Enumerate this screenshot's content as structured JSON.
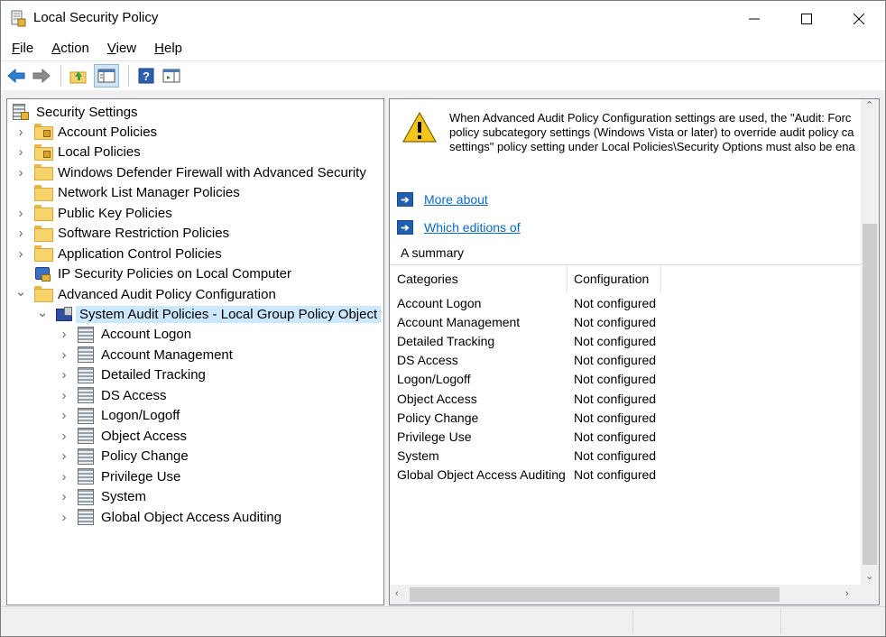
{
  "window": {
    "title": "Local Security Policy",
    "minimize_icon": "minimize-icon",
    "maximize_icon": "maximize-icon",
    "close_icon": "close-icon"
  },
  "menu": [
    {
      "label": "File",
      "accel": "F"
    },
    {
      "label": "Action",
      "accel": "A"
    },
    {
      "label": "View",
      "accel": "V"
    },
    {
      "label": "Help",
      "accel": "H"
    }
  ],
  "toolbar": [
    "back-arrow-icon",
    "forward-arrow-icon",
    "up-folder-icon",
    "show-hide-console-tree-icon",
    "help-icon",
    "show-hide-action-pane-icon"
  ],
  "tree": {
    "root": "Security Settings",
    "items": [
      {
        "label": "Account Policies",
        "expander": "collapsed",
        "icon": "folder-lock-icon"
      },
      {
        "label": "Local Policies",
        "expander": "collapsed",
        "icon": "folder-lock-icon"
      },
      {
        "label": "Windows Defender Firewall with Advanced Security",
        "expander": "collapsed",
        "icon": "folder-icon"
      },
      {
        "label": "Network List Manager Policies",
        "expander": "none",
        "icon": "folder-icon"
      },
      {
        "label": "Public Key Policies",
        "expander": "collapsed",
        "icon": "folder-icon"
      },
      {
        "label": "Software Restriction Policies",
        "expander": "collapsed",
        "icon": "folder-icon"
      },
      {
        "label": "Application Control Policies",
        "expander": "collapsed",
        "icon": "folder-icon"
      },
      {
        "label": "IP Security Policies on Local Computer",
        "expander": "none",
        "icon": "ip-security-icon"
      },
      {
        "label": "Advanced Audit Policy Configuration",
        "expander": "expanded",
        "icon": "folder-icon"
      }
    ],
    "selected": "System Audit Policies - Local Group Policy Object",
    "children": [
      "Account Logon",
      "Account Management",
      "Detailed Tracking",
      "DS Access",
      "Logon/Logoff",
      "Object Access",
      "Policy Change",
      "Privilege Use",
      "System",
      "Global Object Access Auditing"
    ]
  },
  "details": {
    "warning_lines": [
      "When Advanced Audit Policy Configuration settings are used, the \"Audit: Forc",
      "policy subcategory settings (Windows Vista or later) to override audit policy ca",
      "settings\" policy setting under Local Policies\\Security Options must also be ena"
    ],
    "link1": "More about",
    "link2": "Which editions of",
    "summary": "A summary",
    "columns": [
      "Categories",
      "Configuration"
    ],
    "rows": [
      [
        "Account Logon",
        "Not configured"
      ],
      [
        "Account Management",
        "Not configured"
      ],
      [
        "Detailed Tracking",
        "Not configured"
      ],
      [
        "DS Access",
        "Not configured"
      ],
      [
        "Logon/Logoff",
        "Not configured"
      ],
      [
        "Object Access",
        "Not configured"
      ],
      [
        "Policy Change",
        "Not configured"
      ],
      [
        "Privilege Use",
        "Not configured"
      ],
      [
        "System",
        "Not configured"
      ],
      [
        "Global Object Access Auditing",
        "Not configured"
      ]
    ]
  }
}
